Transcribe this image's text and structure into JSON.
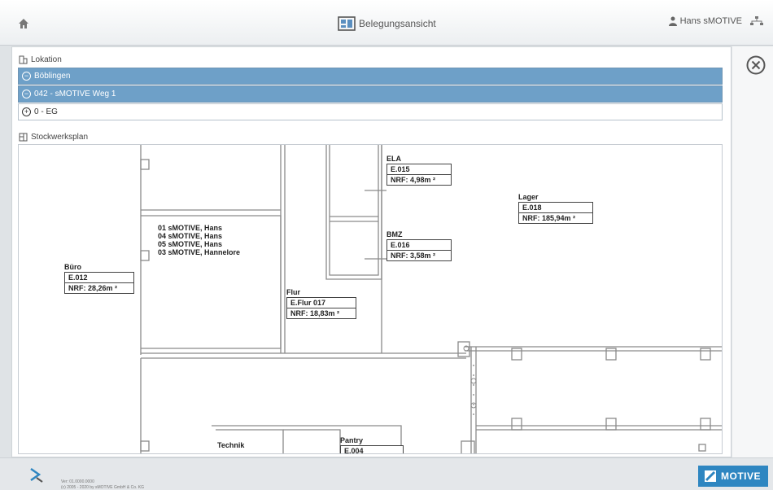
{
  "header": {
    "title": "Belegungsansicht",
    "user": "Hans sMOTIVE"
  },
  "location": {
    "label": "Lokation",
    "items": [
      {
        "label": "Böblingen",
        "toggle": "−"
      },
      {
        "label": "042 - sMOTIVE Weg 1",
        "toggle": "−"
      },
      {
        "label": "0 - EG",
        "toggle": "+"
      }
    ]
  },
  "floorplan": {
    "label": "Stockwerksplan",
    "occupants": [
      "01 sMOTIVE, Hans",
      "04 sMOTIVE, Hans",
      "05 sMOTIVE, Hans",
      "03 sMOTIVE, Hannelore"
    ],
    "rooms": [
      {
        "name": "ELA",
        "code": "E.015",
        "area": "NRF: 4,98m ²"
      },
      {
        "name": "Lager",
        "code": "E.018",
        "area": "NRF: 185,94m ²"
      },
      {
        "name": "BMZ",
        "code": "E.016",
        "area": "NRF: 3,58m ²"
      },
      {
        "name": "Büro",
        "code": "E.012",
        "area": "NRF: 28,26m ²"
      },
      {
        "name": "Flur",
        "code": "E.Flur 017",
        "area": "NRF: 18,83m ²"
      },
      {
        "name": "Technik"
      },
      {
        "name": "Pantry",
        "code": "E.004"
      }
    ]
  },
  "footer": {
    "line1": "Ver: 01.0000.0000",
    "line2": "(c) 2005 - 2020 by sMOTIVE GmbH & Co. KG",
    "brand": "MOTIVE"
  },
  "colors": {
    "selected": "#6ea0c8",
    "brand": "#2e86c1"
  }
}
